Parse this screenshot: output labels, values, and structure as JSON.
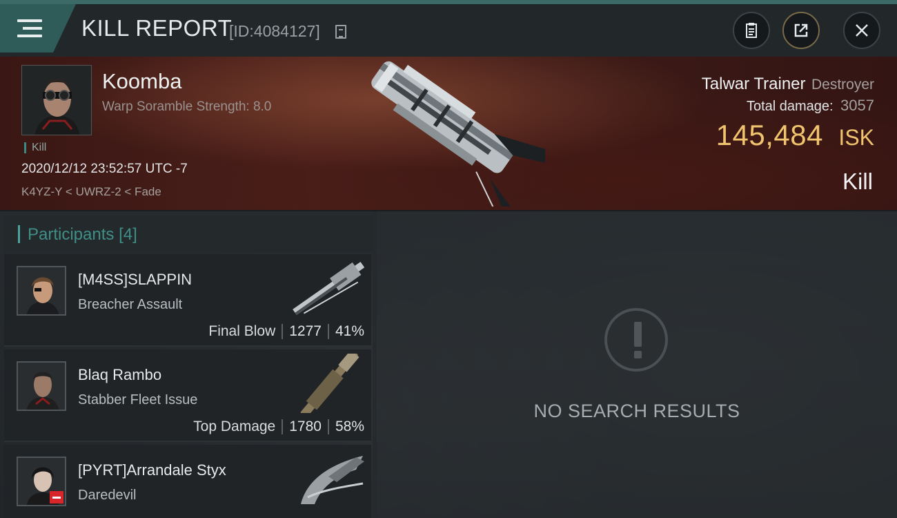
{
  "header": {
    "title": "KILL REPORT",
    "report_id": "[ID:4084127]",
    "menu_icon": "hamburger-menu-icon",
    "buttons": [
      {
        "name": "clipboard-icon"
      },
      {
        "name": "share-icon"
      },
      {
        "name": "close-icon"
      }
    ]
  },
  "victim": {
    "name": "Koomba",
    "warp_scramble": "Warp Soramble Strength: 8.0",
    "tag": "Kill",
    "datetime": "2020/12/12 23:52:57 UTC -7",
    "location": "K4YZ-Y < UWRZ-2 < Fade",
    "ship_name": "Talwar Trainer",
    "ship_class": "Destroyer",
    "total_damage_label": "Total damage:",
    "total_damage": "3057",
    "isk_value": "145,484",
    "isk_unit": "ISK",
    "status": "Kill"
  },
  "participants": {
    "label": "Participants",
    "count": "[4]",
    "rows": [
      {
        "name": "[M4SS]SLAPPIN",
        "ship": "Breacher Assault",
        "role": "Final Blow",
        "damage": "1277",
        "percent": "41%"
      },
      {
        "name": "Blaq Rambo",
        "ship": "Stabber Fleet Issue",
        "role": "Top Damage",
        "damage": "1780",
        "percent": "58%"
      },
      {
        "name": "[PYRT]Arrandale Styx",
        "ship": "Daredevil",
        "role": "",
        "damage": "",
        "percent": ""
      }
    ]
  },
  "results": {
    "message": "NO SEARCH RESULTS"
  },
  "colors": {
    "accent": "#2f5c58",
    "isk_gold": "#f0c46e",
    "hero_red": "#3a1714"
  }
}
